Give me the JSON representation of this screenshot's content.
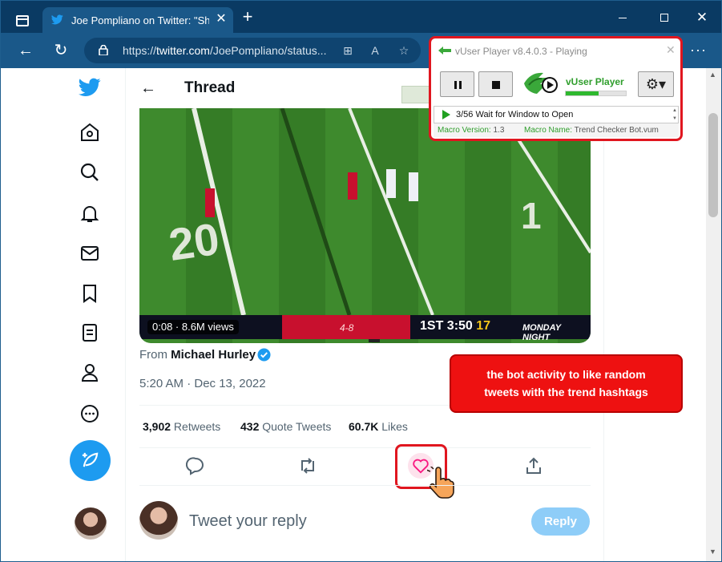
{
  "browser": {
    "tab_title": "Joe Pompliano on Twitter: \"Shou",
    "url_prefix": "https://",
    "url_host": "twitter.com",
    "url_path": "/JoePompliano/status...",
    "tab_close_glyph": "✕",
    "new_tab_glyph": "+",
    "more_glyph": "···"
  },
  "header": {
    "back_glyph": "←",
    "title": "Thread"
  },
  "video": {
    "overlay": "0:08 · 8.6M views",
    "score_record": "4-8",
    "score_text": "1ST 3:50",
    "score_mnf": "MONDAY NIGHT",
    "quarter_time_highlight": "17"
  },
  "tweet": {
    "from_prefix": "From ",
    "from_name": "Michael Hurley",
    "timestamp": "5:20 AM · Dec 13, 2022",
    "stats": [
      {
        "count": "3,902",
        "label": " Retweets"
      },
      {
        "count": "432",
        "label": " Quote Tweets"
      },
      {
        "count": "60.7K",
        "label": " Likes"
      }
    ]
  },
  "reply": {
    "placeholder": "Tweet your reply",
    "button": "Reply"
  },
  "vuser": {
    "title": "vUser Player v8.4.0.3 - Playing",
    "close_glyph": "✕",
    "brand": "vUser Player",
    "progress_fraction": 0.55,
    "gear_glyph": "⚙▾",
    "status": "3/56 Wait for Window to Open",
    "macro_version_label": "Macro Version: ",
    "macro_version": "1.3",
    "macro_name_label": "Macro Name: ",
    "macro_name": "Trend Checker Bot.vum"
  },
  "annotation": {
    "line1": "the bot activity to like random",
    "line2": "tweets with the trend hashtags"
  },
  "colors": {
    "twitter_blue": "#1d9bf0",
    "browser_dark": "#0a3a63",
    "highlight_red": "#e0161f"
  },
  "icons": [
    "twitter-logo-icon",
    "home-icon",
    "explore-icon",
    "notifications-icon",
    "messages-icon",
    "bookmarks-icon",
    "lists-icon",
    "profile-icon",
    "more-icon",
    "compose-icon",
    "reply-icon",
    "retweet-icon",
    "like-icon",
    "share-icon",
    "verified-icon",
    "lock-icon",
    "hand-cursor-icon"
  ]
}
